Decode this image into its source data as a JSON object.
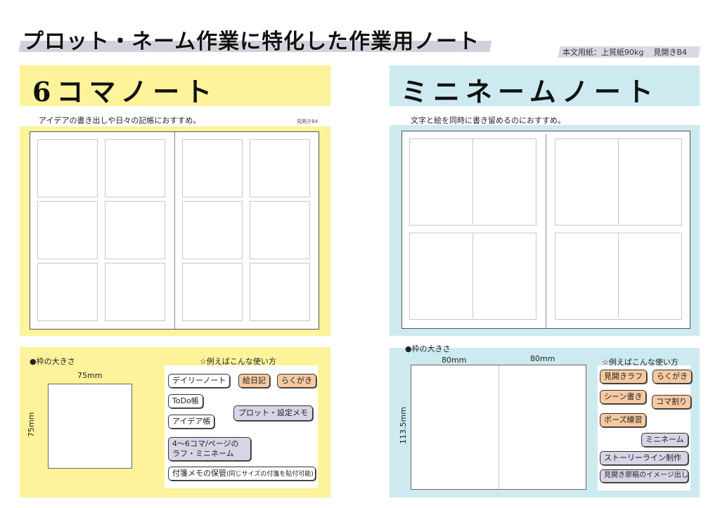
{
  "header": {
    "title": "プロット・ネーム作業に特化した作業用ノート",
    "spec_paper": "本文用紙：上質紙90kg",
    "spec_size": "見開きB4"
  },
  "colors": {
    "left_accent": "#fdf39a",
    "right_accent": "#cdeaf0",
    "chip_orange": "#f7c9a0",
    "chip_purple": "#d8d4e6",
    "title_band": "#d4cfdc"
  },
  "left": {
    "title": "6コマノート",
    "description": "アイデアの書き出しや日々の記帳におすすめ。",
    "size_note": "見開きB4",
    "layout": {
      "pages": 2,
      "panels_per_page": 6,
      "columns": 2,
      "rows": 3
    },
    "frame_size": {
      "heading": "●枠の大きさ",
      "width": "75mm",
      "height": "75mm"
    },
    "usage": {
      "heading": "☆例えばこんな使い方",
      "items": [
        {
          "label": "デイリーノート",
          "style": "white"
        },
        {
          "label": "絵日記",
          "style": "orange"
        },
        {
          "label": "らくがき",
          "style": "orange"
        },
        {
          "label": "ToDo帳",
          "style": "white"
        },
        {
          "label": "プロット・設定メモ",
          "style": "purple"
        },
        {
          "label": "アイデア帳",
          "style": "white"
        },
        {
          "label": "4～6コマ/ページの",
          "label2": "ラフ・ミニネーム",
          "style": "purple"
        },
        {
          "label": "付箋メモの保管",
          "note": "(同じサイズの付箋を貼付可能)",
          "style": "white"
        }
      ]
    }
  },
  "right": {
    "title": "ミニネームノート",
    "description": "文字と絵を同時に書き留めるのにおすすめ。",
    "layout": {
      "pages": 2,
      "panels_per_page": 2,
      "columns": 1,
      "rows": 2,
      "split": "vertical-half"
    },
    "frame_size": {
      "heading": "●枠の大きさ",
      "width_left": "80mm",
      "width_right": "80mm",
      "height": "113.5mm"
    },
    "usage": {
      "heading": "☆例えばこんな使い方",
      "items": [
        {
          "label": "見開きラフ",
          "style": "orange"
        },
        {
          "label": "らくがき",
          "style": "orange"
        },
        {
          "label": "シーン書き",
          "style": "orange"
        },
        {
          "label": "コマ割り",
          "style": "orange"
        },
        {
          "label": "ポーズ練習",
          "style": "orange"
        },
        {
          "label": "ミニネーム",
          "style": "purple"
        },
        {
          "label": "ストーリーライン制作",
          "style": "purple"
        },
        {
          "label": "見開き原稿のイメージ出し",
          "style": "purple"
        }
      ]
    }
  }
}
